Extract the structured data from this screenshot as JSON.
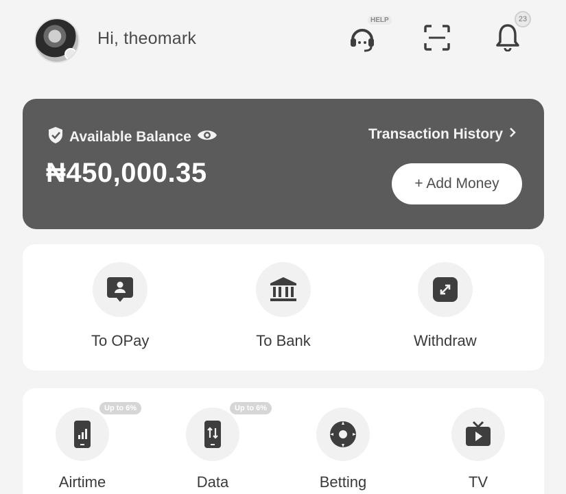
{
  "header": {
    "greeting": "Hi, theomark",
    "help_tag": "HELP",
    "notification_count": "23"
  },
  "balance": {
    "label": "Available Balance",
    "amount": "₦450,000.35",
    "history_link": "Transaction History",
    "add_money": "+ Add Money"
  },
  "actions": [
    {
      "label": "To OPay",
      "icon": "contact-card-icon"
    },
    {
      "label": "To Bank",
      "icon": "bank-icon"
    },
    {
      "label": "Withdraw",
      "icon": "withdraw-arrow-icon"
    }
  ],
  "services": [
    {
      "label": "Airtime",
      "icon": "phone-signal-icon",
      "promo": "Up to 6%"
    },
    {
      "label": "Data",
      "icon": "phone-data-icon",
      "promo": "Up to 6%"
    },
    {
      "label": "Betting",
      "icon": "football-icon",
      "promo": ""
    },
    {
      "label": "TV",
      "icon": "tv-icon",
      "promo": ""
    }
  ],
  "colors": {
    "card_bg": "#5b5b5b",
    "icon_fill": "#3e3e3e",
    "page_bg": "#f4f4f4"
  }
}
